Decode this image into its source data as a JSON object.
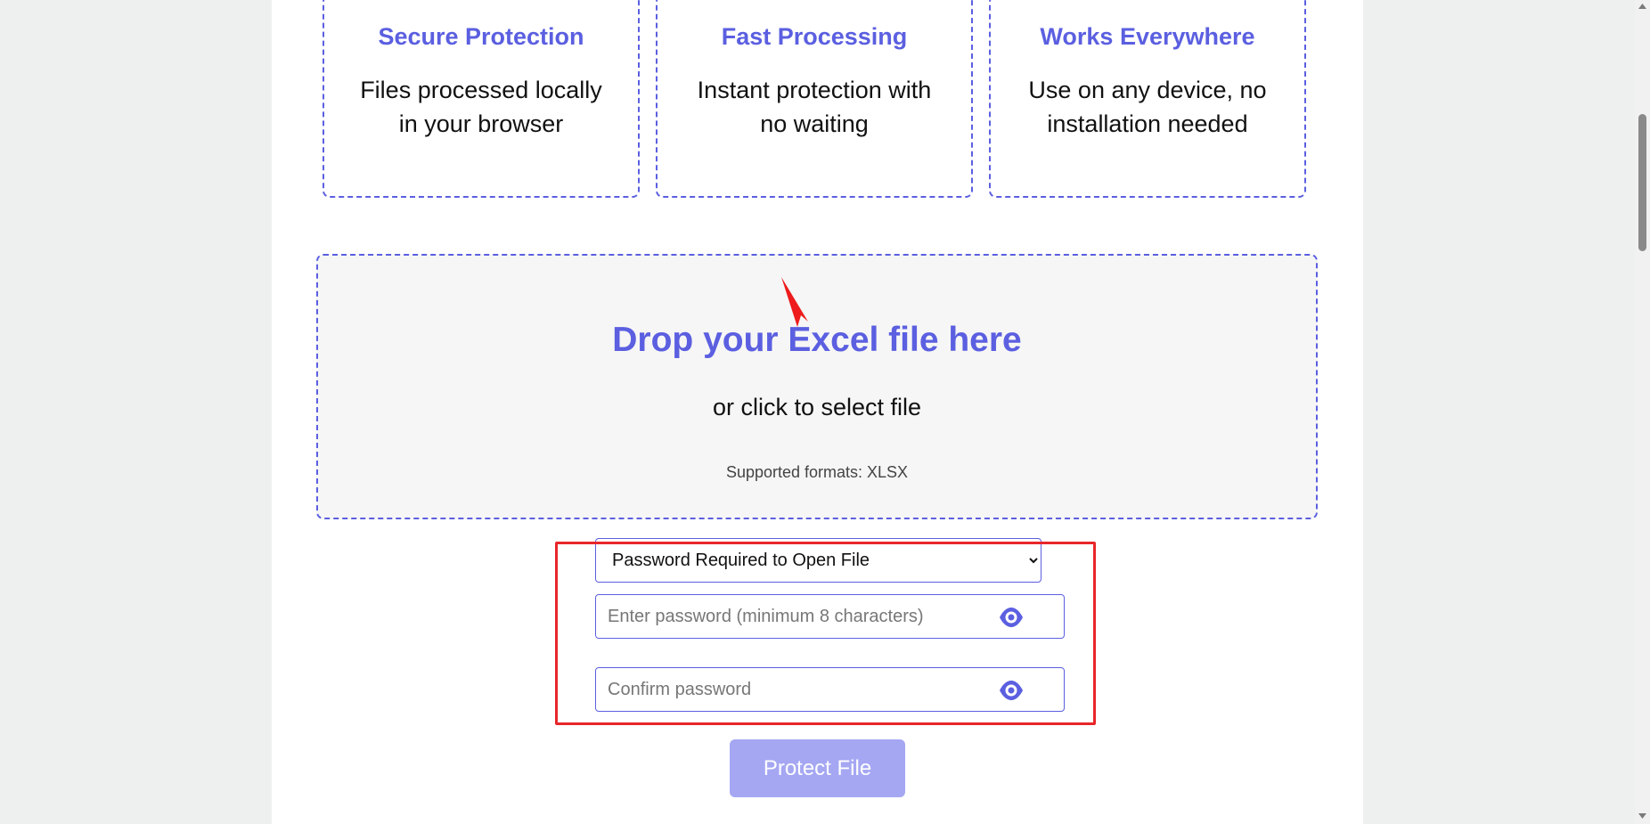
{
  "features": [
    {
      "title": "Secure Protection",
      "description": "Files processed locally in your browser"
    },
    {
      "title": "Fast Processing",
      "description": "Instant protection with no waiting"
    },
    {
      "title": "Works Everywhere",
      "description": "Use on any device, no installation needed"
    }
  ],
  "dropzone": {
    "title": "Drop your Excel file here",
    "subtitle": "or click to select file",
    "formats": "Supported formats: XLSX"
  },
  "protection": {
    "selected_option": "Password Required to Open File",
    "password_placeholder": "Enter password (minimum 8 characters)",
    "confirm_placeholder": "Confirm password",
    "password_value": "",
    "confirm_value": ""
  },
  "submit": {
    "label": "Protect File"
  },
  "icons": {
    "visibility": "eye-icon",
    "cursor": "cursor-arrow-icon"
  },
  "colors": {
    "accent": "#5b5fe0",
    "button_disabled": "#a5a7f3",
    "highlight": "#e8262a",
    "dropzone_bg": "#f6f6f6"
  }
}
